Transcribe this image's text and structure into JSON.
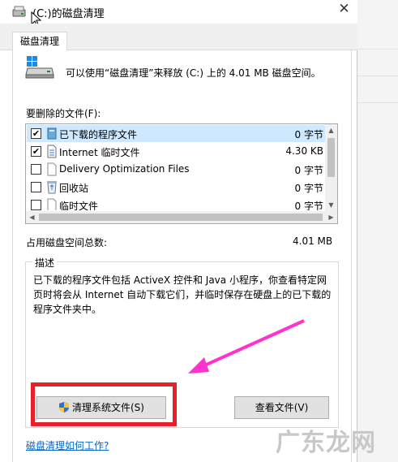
{
  "window": {
    "title": "(C:)的磁盘清理",
    "close_glyph": "✕"
  },
  "tabs": [
    {
      "label": "磁盘清理"
    }
  ],
  "summary": "可以使用“磁盘清理”来释放  (C:) 上的 4.01 MB 磁盘空间。",
  "files_label": "要删除的文件(F):",
  "files": [
    {
      "checked": true,
      "name": "已下载的程序文件",
      "size": "0 字节",
      "icon": "folder-icon",
      "selected": true
    },
    {
      "checked": true,
      "name": "Internet 临时文件",
      "size": "4.30 KB",
      "icon": "document-icon",
      "selected": false
    },
    {
      "checked": false,
      "name": "Delivery Optimization Files",
      "size": "0 字节",
      "icon": "blank-page-icon",
      "selected": false
    },
    {
      "checked": false,
      "name": "回收站",
      "size": "0 字节",
      "icon": "recycle-bin-icon",
      "selected": false
    },
    {
      "checked": false,
      "name": "临时文件",
      "size": "0 字节",
      "icon": "blank-page-icon",
      "selected": false
    }
  ],
  "total_label": "占用磁盘空间总数:",
  "total_value": "4.01 MB",
  "description": {
    "legend": "描述",
    "text": "已下载的程序文件包括 ActiveX 控件和 Java 小程序，你查看特定网页时将会从 Internet 自动下载它们，并临时保存在硬盘上的已下载的程序文件夹中。"
  },
  "buttons": {
    "clean_system": "清理系统文件(S)",
    "view_files": "查看文件(V)"
  },
  "help_link": "磁盘清理如何工作?",
  "watermark": "广东龙网",
  "colors": {
    "highlight_box": "#e8202a",
    "annotation_arrow": "#ff33cc",
    "selection": "#cde8ff",
    "link": "#0066cc"
  }
}
